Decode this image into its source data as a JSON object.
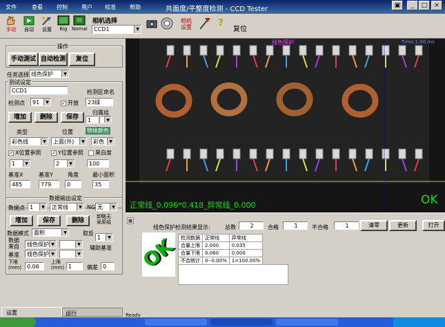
{
  "window": {
    "title": "共面度/平整度检测 - CCD Tester",
    "menu": [
      "文件",
      "查看",
      "控制",
      "用户",
      "校准",
      "帮助"
    ]
  },
  "toolbar": {
    "manual": "手动",
    "auto": "自动",
    "settings": "设置",
    "big": "Big",
    "normal": "Nomal",
    "camera_select_label": "相机选择",
    "camera_value": "CCD1",
    "camera_settings": "相机\n设置",
    "reset": "复位"
  },
  "left": {
    "op_group": "操作",
    "manual_test": "手动测试",
    "auto_detect": "自动检测",
    "reset": "复位",
    "task_label": "任务选择",
    "task_value": "线色保护",
    "test_settings": "测试设定",
    "ccd_value": "CCD1",
    "region_name_label": "检测区命名",
    "detect_point_label": "检测点",
    "detect_point_value": "91",
    "enable_label": "开放",
    "region_name_value": "23绿",
    "add": "增加",
    "delete": "删除",
    "save": "保存",
    "group_label": "归属组",
    "group_value": "1",
    "type_label": "类型",
    "position_label": "位置",
    "color_label": "物体颜色",
    "type_value": "彩色线",
    "position_value": "上面(外)",
    "color_value": "彩色",
    "x_ref": "X位置参照",
    "y_ref": "Y位置参照",
    "black_white": "黑白度",
    "x_ref_value": "1",
    "y_ref_value": "2",
    "bw_value": "100",
    "base_x": "基准X",
    "base_y": "基准Y",
    "angle": "角度",
    "min_area": "最小面积",
    "base_x_value": "485",
    "base_y_value": "779",
    "angle_value": "0",
    "min_area_value": "35",
    "data_out_group": "数据输出设定",
    "data_point_label": "数据点",
    "data_point_value": "1",
    "normal_line_value": "正常线",
    "ng_label": "NG",
    "none_value": "无",
    "add2": "增加",
    "save2": "保存",
    "delete2": "删除",
    "lim_label": "卸略无\n采原组",
    "data_mode_label": "数据模式",
    "data_mode_value": "面积",
    "abs_label": "取反",
    "abs_value": "1",
    "source_label": "数据\n来自",
    "source_value": "线色保护",
    "aux_label": "辅助基准",
    "base_label": "基准",
    "base_value": "线色保护",
    "lower_label": "下限\n(mm)",
    "lower_value": "0.06",
    "upper_label": "上限\n(mm)",
    "upper_value": "1",
    "offset_label": "偏差",
    "offset_value": "0",
    "tab_settings": "设置",
    "tab_run": "运行"
  },
  "camera": {
    "label": "线色保护",
    "timer": "Time:1.90 ms",
    "result_line": "正常线_0.096*0.418_异常线_0.000",
    "ok": "OK"
  },
  "bottom": {
    "title": "线色保护检测结果显示:",
    "total_label": "总数",
    "total_value": "2",
    "pass_label": "合格",
    "pass_value": "1",
    "fail_label": "不合格",
    "fail_value": "1",
    "clear": "清零",
    "update": "更新",
    "open": "打开",
    "ok_logo": "OK",
    "table": {
      "headers": [
        "检测数据",
        "正常线",
        "异常线"
      ],
      "rows": [
        [
          "合量上限",
          "2.000",
          "0.035"
        ],
        [
          "合量下限",
          "0.060",
          "0.000"
        ],
        [
          "不合统计",
          "0--0.00%",
          "1=100.00%"
        ]
      ]
    },
    "status": "Ready"
  },
  "colors": {
    "ok": "#00d000",
    "accent": "#0a246a",
    "camera_bg": "#151515",
    "text_green": "#00e000"
  }
}
